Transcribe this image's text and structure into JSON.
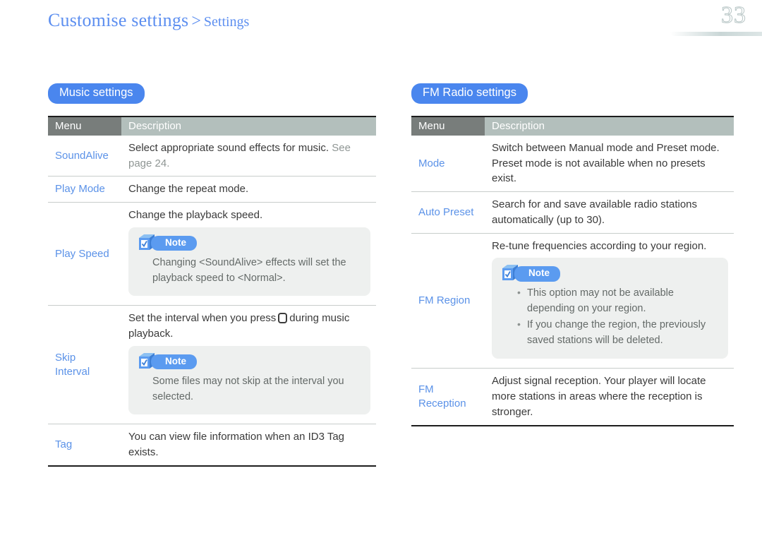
{
  "header": {
    "breadcrumb_main": "Customise settings",
    "breadcrumb_separator": ">",
    "breadcrumb_sub": "Settings",
    "page_number": "33"
  },
  "colors": {
    "accent_blue": "#4a86ee",
    "link_blue": "#5b92e8",
    "header_menu_bg": "#787d7b",
    "header_desc_bg": "#b3bfbc",
    "note_bg": "#eef0ef",
    "note_pill": "#5b9bf0"
  },
  "music": {
    "section_title": "Music settings",
    "columns": {
      "menu": "Menu",
      "description": "Description"
    },
    "rows": [
      {
        "menu": "SoundAlive",
        "desc_main": "Select appropriate sound effects for music.",
        "desc_muted": "See page 24."
      },
      {
        "menu": "Play Mode",
        "desc_main": "Change the repeat mode."
      },
      {
        "menu": "Play Speed",
        "desc_main": "Change the playback speed.",
        "note": {
          "label": "Note",
          "text": "Changing <SoundAlive> effects will set the playback speed to <Normal>."
        }
      },
      {
        "menu_line1": "Skip",
        "menu_line2": "Interval",
        "desc_before_icon": "Set the interval when you press",
        "desc_after_icon": "during music playback.",
        "note": {
          "label": "Note",
          "text": "Some files may not skip at the interval you selected."
        }
      },
      {
        "menu": "Tag",
        "desc_main": "You can view file information when an ID3 Tag exists."
      }
    ]
  },
  "fm_radio": {
    "section_title": "FM Radio settings",
    "columns": {
      "menu": "Menu",
      "description": "Description"
    },
    "rows": [
      {
        "menu": "Mode",
        "desc_main": "Switch between Manual mode and Preset mode. Preset mode is not available when no presets exist."
      },
      {
        "menu": "Auto Preset",
        "desc_main": "Search for and save available radio stations automatically (up to 30)."
      },
      {
        "menu": "FM Region",
        "desc_main": "Re-tune frequencies according to your region.",
        "note": {
          "label": "Note",
          "bullets": [
            "This option may not be available depending on your region.",
            "If you change the region, the previously saved stations will be deleted."
          ]
        }
      },
      {
        "menu_line1": "FM",
        "menu_line2": "Reception",
        "desc_main": "Adjust signal reception. Your player will locate more stations in areas where the reception is stronger."
      }
    ]
  }
}
